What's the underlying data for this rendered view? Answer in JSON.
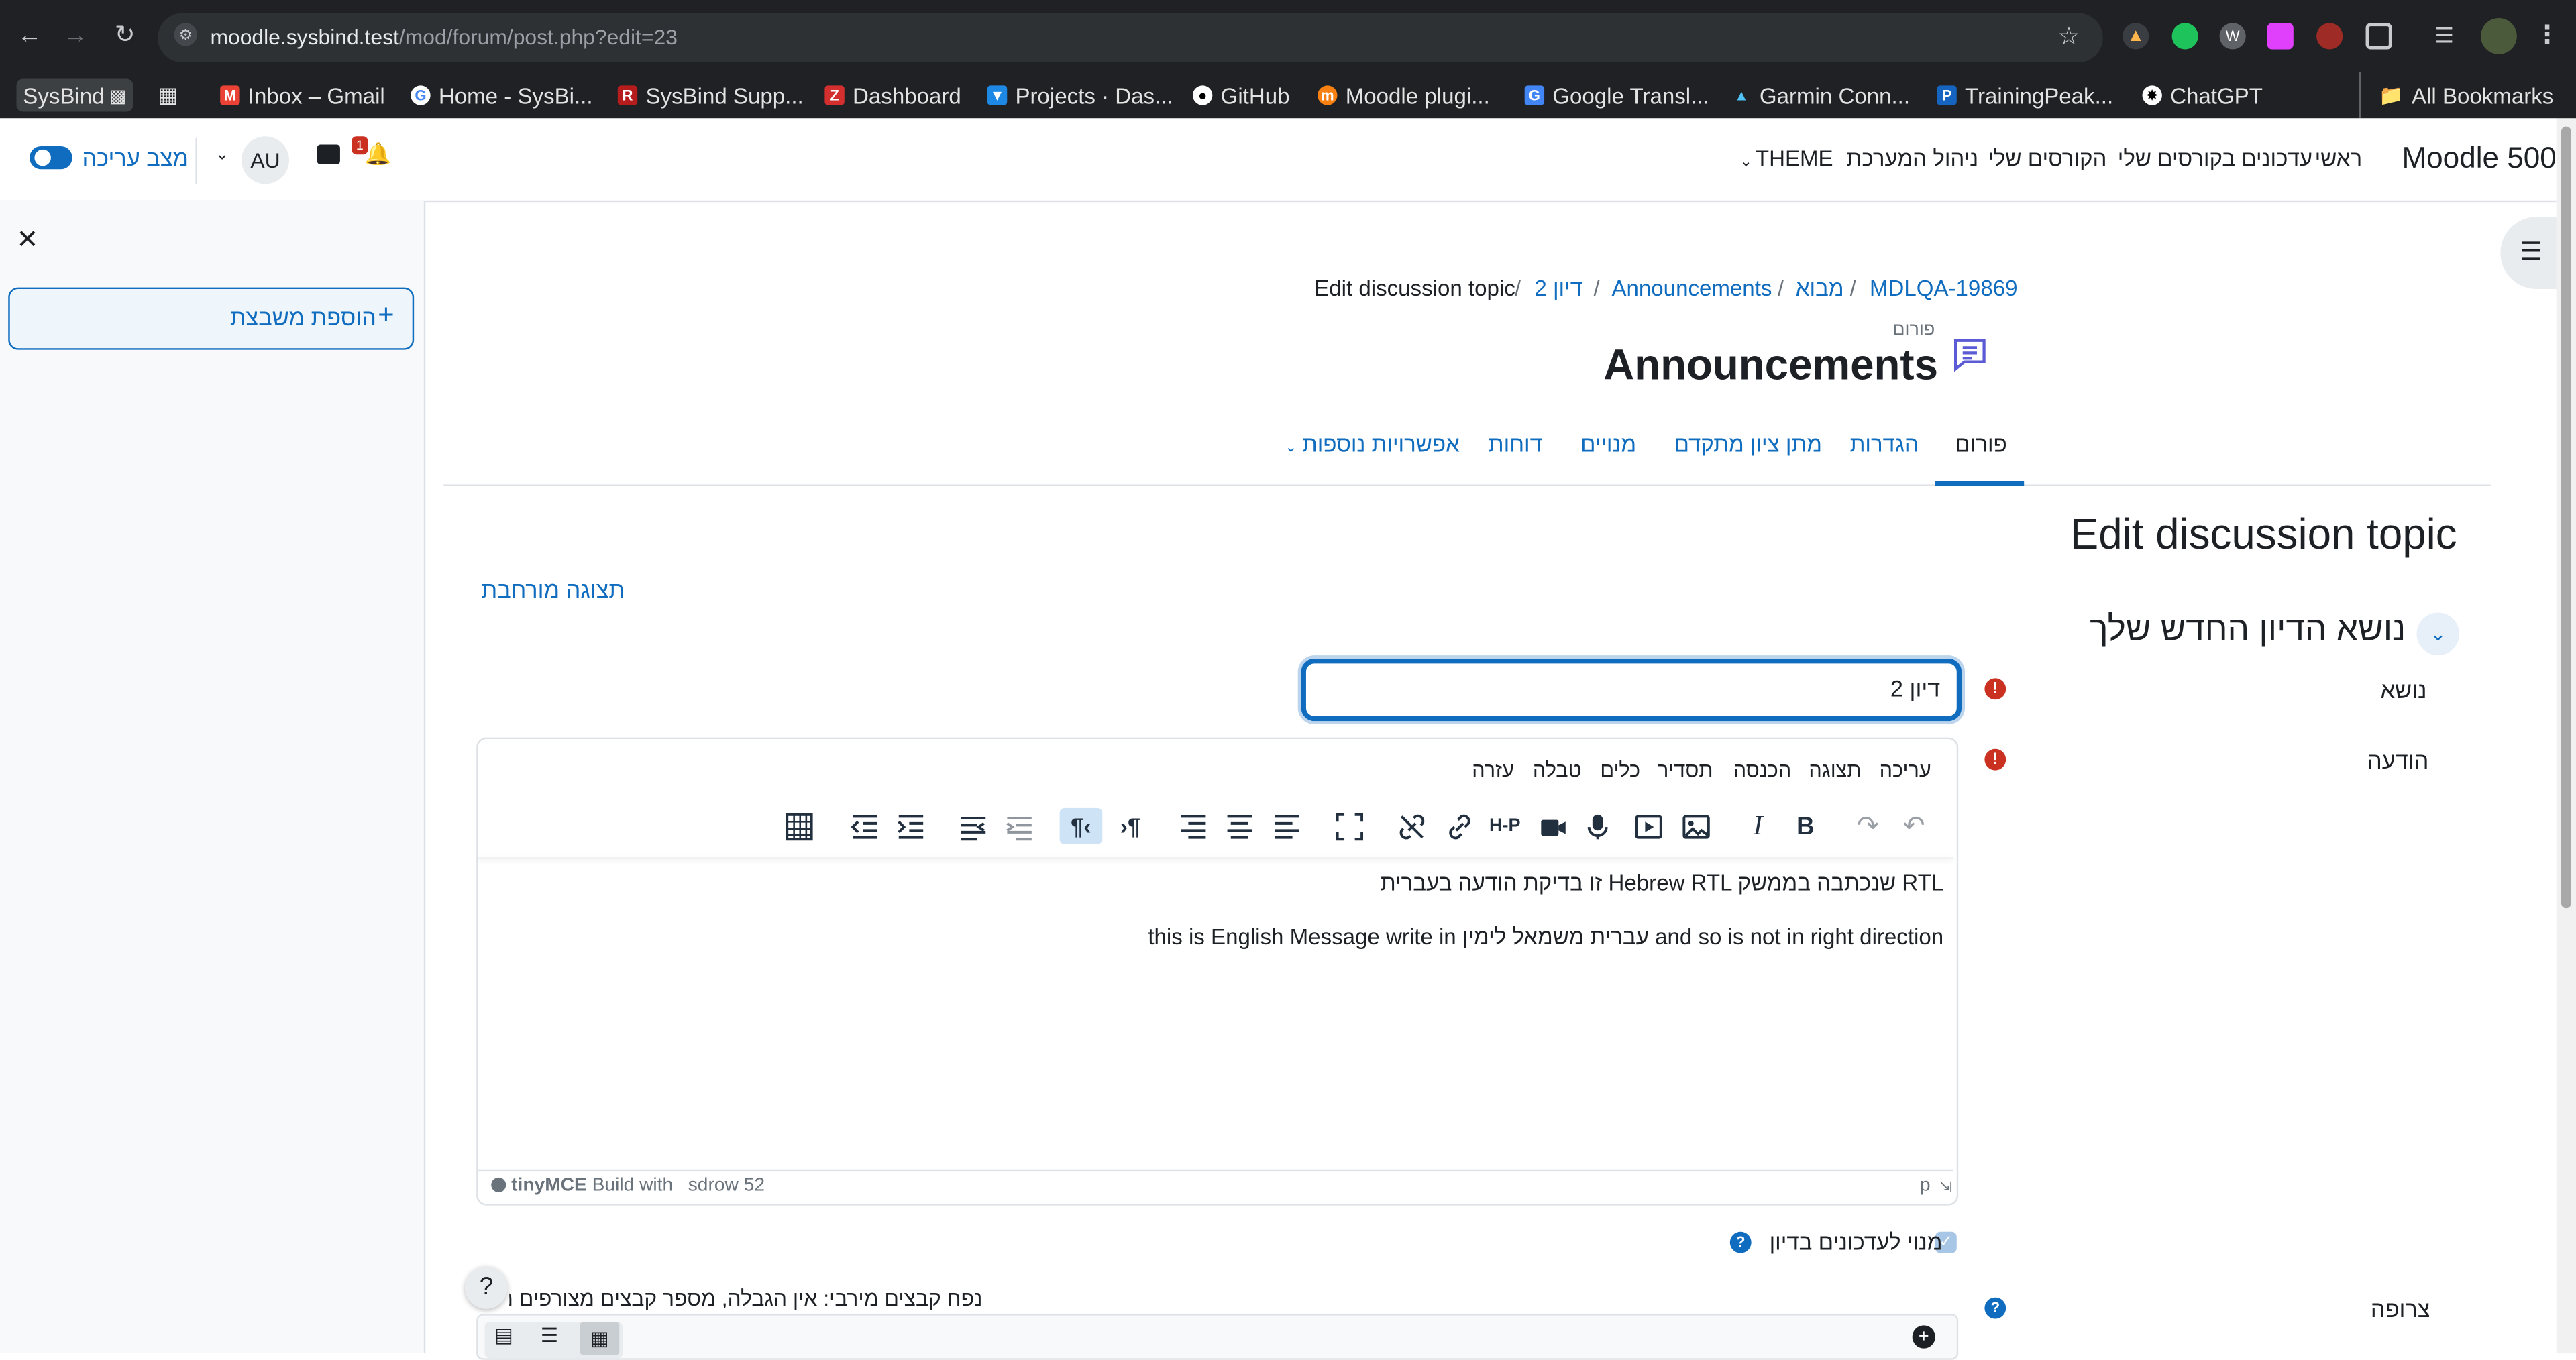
{
  "browser": {
    "url_host": "moodle.sysbind.test",
    "url_path": "/mod/forum/post.php?edit=23",
    "bookmarks": [
      {
        "label": "SysBind",
        "icon": "monitor-icon"
      },
      {
        "label": "Inbox – Gmail",
        "icon": "gmail-icon"
      },
      {
        "label": "Home - SysBi...",
        "icon": "google-icon"
      },
      {
        "label": "SysBind Supp...",
        "icon": "redmine-icon"
      },
      {
        "label": "Dashboard",
        "icon": "zendesk-icon"
      },
      {
        "label": "Projects · Das...",
        "icon": "gitlab-icon"
      },
      {
        "label": "GitHub",
        "icon": "github-icon"
      },
      {
        "label": "Moodle plugi...",
        "icon": "moodle-icon"
      },
      {
        "label": "Google Transl...",
        "icon": "translate-icon"
      },
      {
        "label": "Garmin Conn...",
        "icon": "garmin-icon"
      },
      {
        "label": "TrainingPeak...",
        "icon": "trainingpeaks-icon"
      },
      {
        "label": "ChatGPT",
        "icon": "chatgpt-icon"
      }
    ],
    "all_bookmarks": "All Bookmarks"
  },
  "header": {
    "site_name": "Moodle 500",
    "nav": [
      "ראשי",
      "עדכונים בקורסים שלי",
      "הקורסים שלי",
      "ניהול המערכת",
      "THEME"
    ],
    "edit_mode_label": "מצב עריכה",
    "avatar_initials": "AU",
    "notification_count": "1"
  },
  "drawer": {
    "add_block_label": "הוספת משבצת"
  },
  "breadcrumb": [
    "MDLQA-19869",
    "מבוא",
    "Announcements",
    "דיון 2",
    "Edit discussion topic"
  ],
  "activity": {
    "type_label": "פורום",
    "title": "Announcements"
  },
  "tabs": [
    "פורום",
    "הגדרות",
    "מתן ציון מתקדם",
    "מנויים",
    "דוחות",
    "אפשרויות נוספות"
  ],
  "page_heading": "Edit discussion topic",
  "expanded_view_link": "תצוגה מורחבת",
  "section_heading": "נושא הדיון החדש שלך",
  "form": {
    "subject_label": "נושא",
    "subject_value": "דיון 2",
    "message_label": "הודעה",
    "editor_menu": [
      "עריכה",
      "תצוגה",
      "הכנסה",
      "תסדיר",
      "כלים",
      "טבלה",
      "עזרה"
    ],
    "message_lines": [
      "זו בדיקת הודעה בעברית Hebrew RTL שנכתבה בממשק RTL",
      "this is English Message write in עברית משמאל לימין and so is not in right direction"
    ],
    "statusbar_path": "p",
    "statusbar_words": "25 words",
    "statusbar_build": "Build with",
    "statusbar_brand": "tinyMCE",
    "subscribe_label": "מנוי לעדכונים בדיון",
    "attachment_label": "צרופה",
    "attachment_info": "נפח קבצים מירבי: אין הגבלה, מספר קבצים מצורפים מירבי"
  }
}
